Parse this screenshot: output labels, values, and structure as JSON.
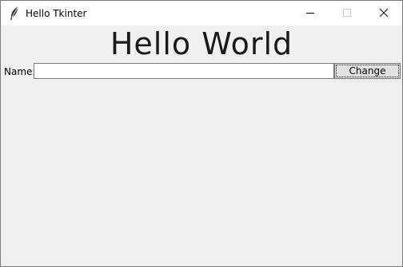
{
  "window": {
    "title": "Hello Tkinter",
    "icon": "feather-icon",
    "controls": [
      "minimize-icon",
      "maximize-icon",
      "close-icon"
    ]
  },
  "main": {
    "heading": "Hello World",
    "name_label": "Name:",
    "name_input_value": "",
    "change_button_label": "Change"
  },
  "colors": {
    "background": "#f0f0f0",
    "titlebar": "#ffffff",
    "button_face": "#e1e1e1",
    "border": "#7a7a7a"
  }
}
